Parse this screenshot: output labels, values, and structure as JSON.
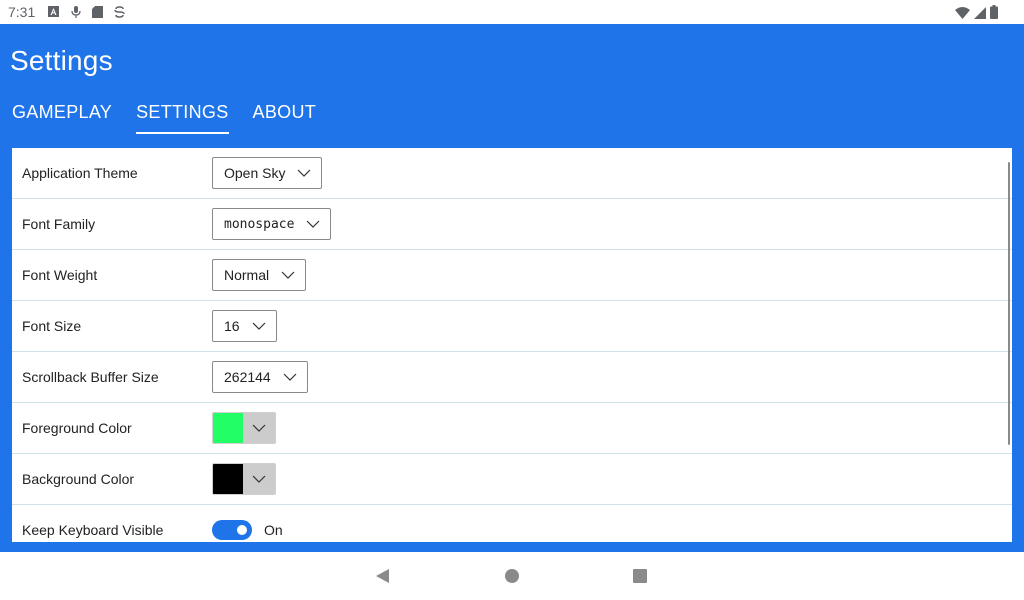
{
  "status_bar": {
    "time": "7:31",
    "left_icons": [
      "a-box-icon",
      "mic-icon",
      "sd-card-icon",
      "sync-icon"
    ],
    "right_icons": [
      "wifi-icon",
      "signal-icon",
      "battery-icon"
    ]
  },
  "app_bar": {
    "title": "Settings",
    "tabs": [
      {
        "label": "GAMEPLAY",
        "active": false
      },
      {
        "label": "SETTINGS",
        "active": true
      },
      {
        "label": "ABOUT",
        "active": false
      }
    ]
  },
  "settings": {
    "rows": [
      {
        "label": "Application Theme",
        "value": "Open Sky"
      },
      {
        "label": "Font Family",
        "value": "monospace"
      },
      {
        "label": "Font Weight",
        "value": "Normal"
      },
      {
        "label": "Font Size",
        "value": "16"
      },
      {
        "label": "Scrollback Buffer Size",
        "value": "262144"
      },
      {
        "label": "Foreground Color",
        "color": "#22ff66"
      },
      {
        "label": "Background Color",
        "color": "#000000"
      },
      {
        "label": "Keep Keyboard Visible",
        "value": "On",
        "enabled": true
      }
    ]
  },
  "colors": {
    "accent": "#1e74e8",
    "divider": "#cfe1ea"
  },
  "nav_bar": {
    "buttons": [
      "back-icon",
      "home-icon",
      "recents-icon"
    ]
  }
}
